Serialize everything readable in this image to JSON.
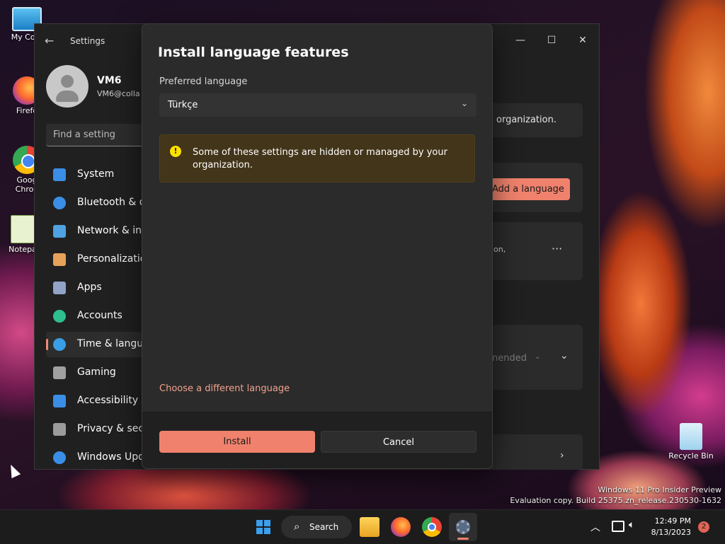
{
  "desktop": {
    "icons": [
      {
        "label": "My Com"
      },
      {
        "label": "Firefo"
      },
      {
        "label": "Goog Chron"
      },
      {
        "label": "Notepa"
      },
      {
        "label": "Recycle Bin"
      }
    ],
    "watermark_line1": "Windows 11 Pro Insider Preview",
    "watermark_line2": "Evaluation copy. Build 25375.zn_release.230530-1632"
  },
  "settings": {
    "app_title": "Settings",
    "user_name": "VM6",
    "user_email": "VM6@colla",
    "search_placeholder": "Find a setting",
    "nav": [
      {
        "label": "System",
        "icon": "monitor-icon",
        "color": "#3a8ee6"
      },
      {
        "label": "Bluetooth & de",
        "icon": "bluetooth-icon",
        "color": "#3a8ee6"
      },
      {
        "label": "Network & inte",
        "icon": "wifi-icon",
        "color": "#4fa3e0"
      },
      {
        "label": "Personalization",
        "icon": "brush-icon",
        "color": "#e6a15a"
      },
      {
        "label": "Apps",
        "icon": "apps-icon",
        "color": "#8fa4c6"
      },
      {
        "label": "Accounts",
        "icon": "person-icon",
        "color": "#2fbf8f"
      },
      {
        "label": "Time & langua",
        "icon": "globe-clock-icon",
        "color": "#3a9ee6"
      },
      {
        "label": "Gaming",
        "icon": "gamepad-icon",
        "color": "#a0a0a0"
      },
      {
        "label": "Accessibility",
        "icon": "accessibility-icon",
        "color": "#3a8ee6"
      },
      {
        "label": "Privacy & secu",
        "icon": "shield-icon",
        "color": "#9c9c9c"
      },
      {
        "label": "Windows Upda",
        "icon": "update-icon",
        "color": "#3a8ee6"
      }
    ],
    "active_nav_index": 6,
    "right": {
      "org_text": "organization.",
      "add_language": "Add a language",
      "partial_text": "on,",
      "more": "···",
      "dropdown_partial": "nended"
    }
  },
  "dialog": {
    "title": "Install language features",
    "preferred_label": "Preferred language",
    "preferred_value": "Türkçe",
    "warning": "Some of these settings are hidden or managed by your organization.",
    "link": "Choose a different language",
    "install": "Install",
    "cancel": "Cancel"
  },
  "taskbar": {
    "search": "Search",
    "time": "12:49 PM",
    "date": "8/13/2023",
    "notifications": "2"
  },
  "colors": {
    "accent": "#f0826d",
    "link": "#f3a28e",
    "warning_bg": "#433519",
    "warning_icon": "#fce100"
  }
}
